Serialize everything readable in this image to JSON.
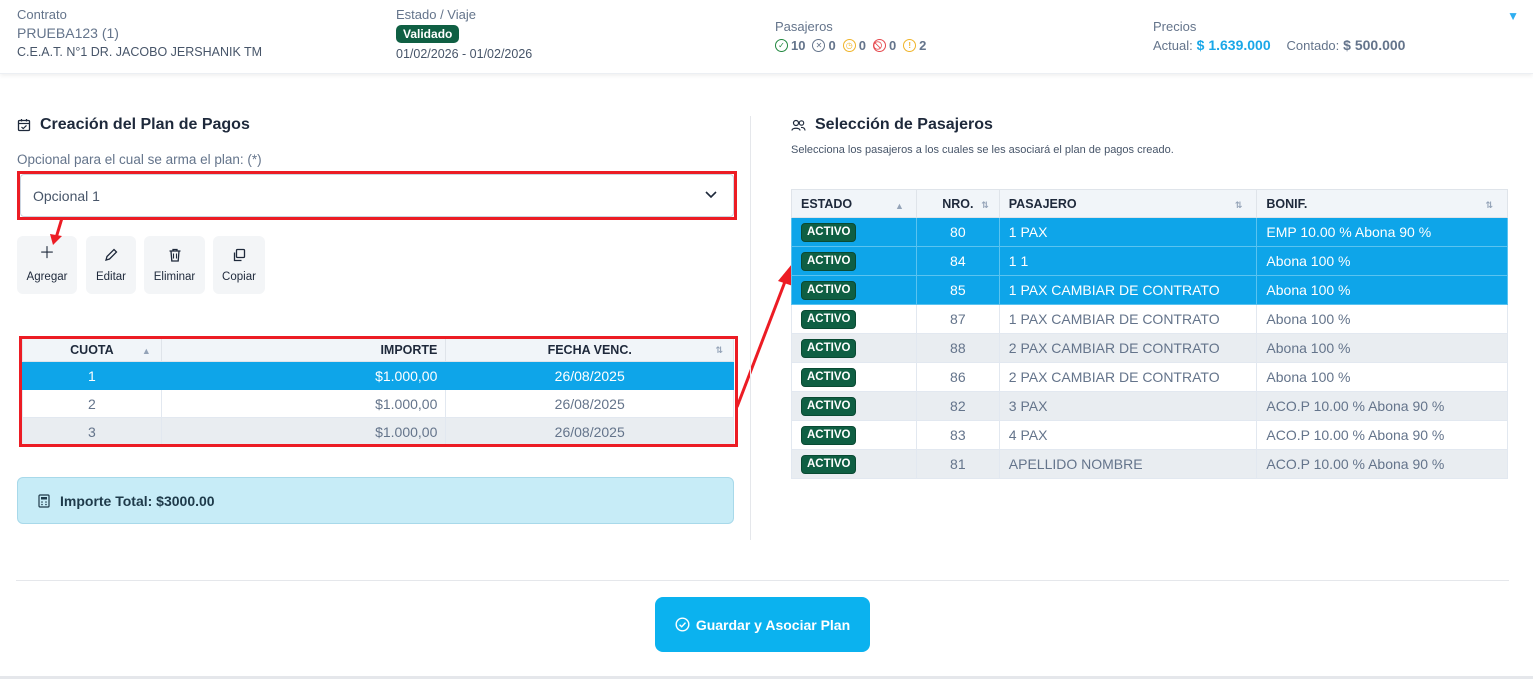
{
  "header": {
    "contrato": {
      "label": "Contrato",
      "code": "PRUEBA123 (1)",
      "school": "C.E.A.T. N°1 DR. JACOBO JERSHANIK TM"
    },
    "estado": {
      "label": "Estado / Viaje",
      "badge": "Validado",
      "dates": "01/02/2026 - 01/02/2026"
    },
    "pasajeros": {
      "label": "Pasajeros",
      "stats": [
        {
          "icon": "check-circle-icon",
          "value": "10",
          "color": "#22883f"
        },
        {
          "icon": "user-x-icon",
          "value": "0",
          "color": "#64748b"
        },
        {
          "icon": "clock-icon",
          "value": "0",
          "color": "#f0b429"
        },
        {
          "icon": "ban-icon",
          "value": "0",
          "color": "#e5484d"
        },
        {
          "icon": "alert-circle-icon",
          "value": "2",
          "color": "#f0b429"
        }
      ]
    },
    "precios": {
      "label": "Precios",
      "actual_label": "Actual:",
      "actual_value": "$ 1.639.000",
      "contado_label": "Contado:",
      "contado_value": "$ 500.000"
    }
  },
  "plan": {
    "title": "Creación del Plan de Pagos",
    "opcional_label": "Opcional para el cual se arma el plan: (*)",
    "opcional_selected": "Opcional 1",
    "toolbar": {
      "agregar": "Agregar",
      "editar": "Editar",
      "eliminar": "Eliminar",
      "copiar": "Copiar"
    },
    "cuotas_columns": [
      "CUOTA",
      "IMPORTE",
      "FECHA VENC."
    ],
    "cuotas": [
      {
        "cuota": "1",
        "importe": "$1.000,00",
        "fecha": "26/08/2025"
      },
      {
        "cuota": "2",
        "importe": "$1.000,00",
        "fecha": "26/08/2025"
      },
      {
        "cuota": "3",
        "importe": "$1.000,00",
        "fecha": "26/08/2025"
      }
    ],
    "total": "Importe Total: $3000.00"
  },
  "pasajeros_sel": {
    "title": "Selección de Pasajeros",
    "subtitle": "Selecciona los pasajeros a los cuales se les asociará el plan de pagos creado.",
    "columns": [
      "ESTADO",
      "NRO.",
      "PASAJERO",
      "BONIF."
    ],
    "rows": [
      {
        "estado": "ACTIVO",
        "nro": "80",
        "pasajero": "1 PAX",
        "bonif": "EMP 10.00 % Abona 90 %"
      },
      {
        "estado": "ACTIVO",
        "nro": "84",
        "pasajero": "1 1",
        "bonif": "Abona 100 %"
      },
      {
        "estado": "ACTIVO",
        "nro": "85",
        "pasajero": "1 PAX CAMBIAR DE CONTRATO",
        "bonif": "Abona 100 %"
      },
      {
        "estado": "ACTIVO",
        "nro": "87",
        "pasajero": "1 PAX CAMBIAR DE CONTRATO",
        "bonif": "Abona 100 %"
      },
      {
        "estado": "ACTIVO",
        "nro": "88",
        "pasajero": "2 PAX CAMBIAR DE CONTRATO",
        "bonif": "Abona 100 %"
      },
      {
        "estado": "ACTIVO",
        "nro": "86",
        "pasajero": "2 PAX CAMBIAR DE CONTRATO",
        "bonif": "Abona 100 %"
      },
      {
        "estado": "ACTIVO",
        "nro": "82",
        "pasajero": "3 PAX",
        "bonif": "ACO.P 10.00 % Abona 90 %"
      },
      {
        "estado": "ACTIVO",
        "nro": "83",
        "pasajero": "4 PAX",
        "bonif": "ACO.P 10.00 % Abona 90 %"
      },
      {
        "estado": "ACTIVO",
        "nro": "81",
        "pasajero": "APELLIDO NOMBRE",
        "bonif": "ACO.P 10.00 % Abona 90 %"
      }
    ]
  },
  "save_button": "Guardar y Asociar Plan",
  "colors": {
    "accent": "#0ea5e9",
    "badge_green": "#0f5f43",
    "annotation_red": "#ec1c24",
    "total_bg": "#c7ecf7"
  }
}
